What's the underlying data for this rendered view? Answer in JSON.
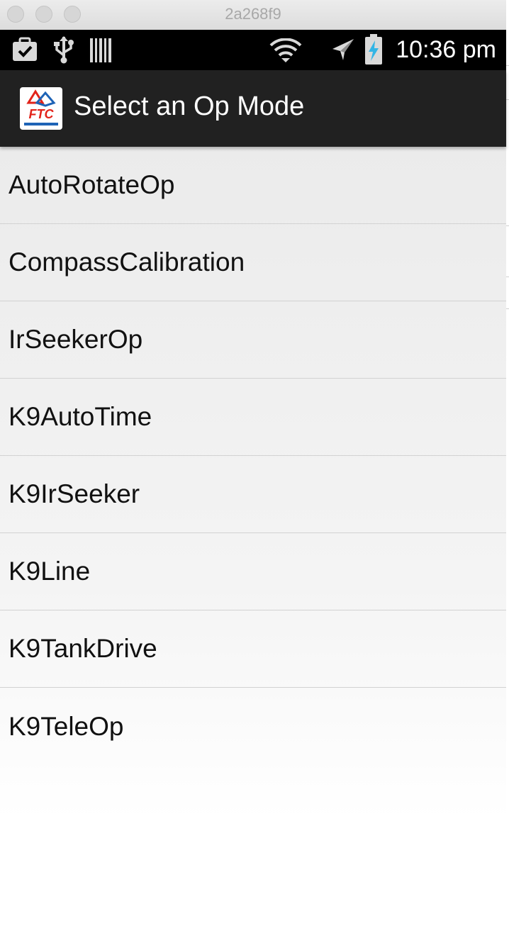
{
  "window": {
    "title": "2a268f9",
    "controls": [
      "close",
      "minimize",
      "zoom"
    ]
  },
  "status_bar": {
    "left_icons": [
      "clipboard-check-icon",
      "usb-icon",
      "barcode-icon"
    ],
    "right_icons": [
      "wifi-icon",
      "airplane-mode-icon",
      "battery-charging-icon"
    ],
    "time": "10:36 pm"
  },
  "action_bar": {
    "logo_text": "FTC",
    "title": "Select an Op Mode"
  },
  "op_modes": [
    {
      "label": "AutoRotateOp"
    },
    {
      "label": "CompassCalibration"
    },
    {
      "label": "IrSeekerOp"
    },
    {
      "label": "K9AutoTime"
    },
    {
      "label": "K9IrSeeker"
    },
    {
      "label": "K9Line"
    },
    {
      "label": "K9TankDrive"
    },
    {
      "label": "K9TeleOp"
    }
  ],
  "colors": {
    "status_bar": "#000000",
    "action_bar": "#212121",
    "list_background": "#f0f0f0",
    "battery_accent": "#33b5e5",
    "ftc_red": "#e2231a",
    "ftc_blue": "#1e63b6"
  }
}
